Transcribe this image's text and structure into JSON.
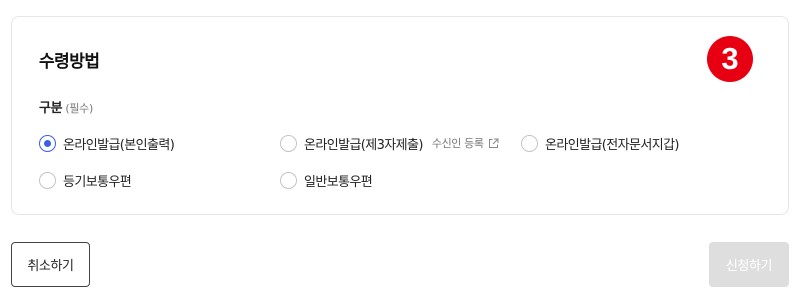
{
  "section": {
    "title": "수령방법",
    "step": "3"
  },
  "field": {
    "label": "구분",
    "required": "(필수)"
  },
  "options": [
    {
      "label": "온라인발급(본인출력)",
      "checked": true
    },
    {
      "label": "온라인발급(제3자제출)",
      "checked": false,
      "link": "수신인 등록",
      "link_icon": "external-link-icon"
    },
    {
      "label": "온라인발급(전자문서지갑)",
      "checked": false
    },
    {
      "label": "등기보통우편",
      "checked": false
    },
    {
      "label": "일반보통우편",
      "checked": false
    }
  ],
  "buttons": {
    "cancel": "취소하기",
    "submit": "신청하기"
  },
  "colors": {
    "accent": "#3a5fe0",
    "badge": "#e60012",
    "disabled": "#dedede"
  }
}
